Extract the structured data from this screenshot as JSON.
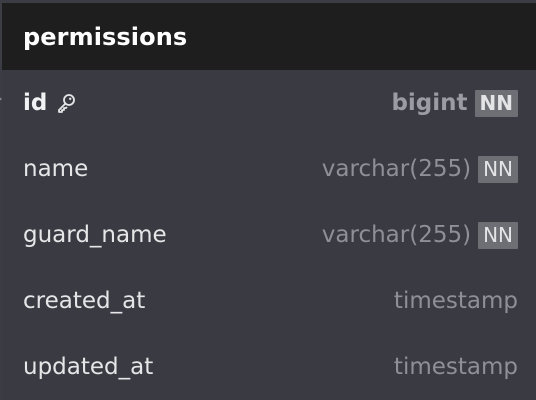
{
  "table": {
    "title": "permissions",
    "columns": [
      {
        "name": "id",
        "type": "bigint",
        "badge": "NN",
        "primary_key": true,
        "icon": "key-icon"
      },
      {
        "name": "name",
        "type": "varchar(255)",
        "badge": "NN",
        "primary_key": false
      },
      {
        "name": "guard_name",
        "type": "varchar(255)",
        "badge": "NN",
        "primary_key": false
      },
      {
        "name": "created_at",
        "type": "timestamp",
        "badge": "",
        "primary_key": false
      },
      {
        "name": "updated_at",
        "type": "timestamp",
        "badge": "",
        "primary_key": false
      }
    ]
  },
  "colors": {
    "background": "#3b3c44",
    "header": "#1e1e1e",
    "badge": "#6e6f75"
  }
}
